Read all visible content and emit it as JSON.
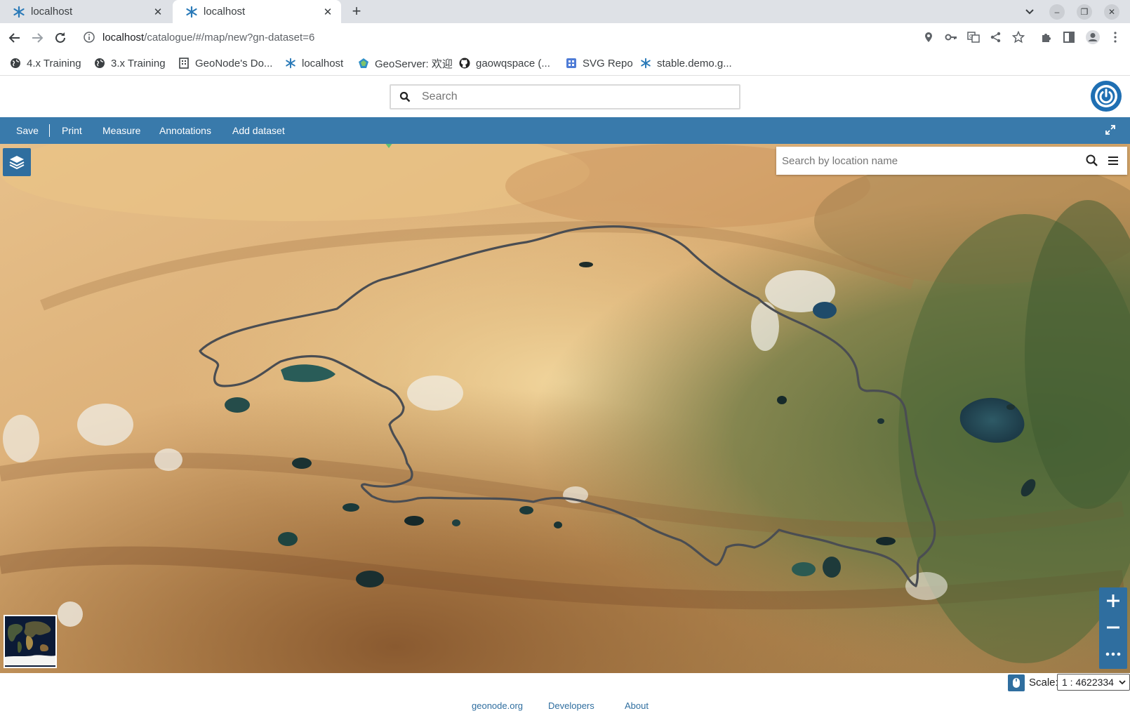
{
  "browser": {
    "tabs": [
      {
        "title": "localhost",
        "active": false
      },
      {
        "title": "localhost",
        "active": true
      }
    ],
    "url_host": "localhost",
    "url_path": "/catalogue/#/map/new?gn-dataset=6",
    "bookmarks": [
      {
        "label": "4.x Training",
        "icon": "globe-icon"
      },
      {
        "label": "3.x Training",
        "icon": "globe-icon"
      },
      {
        "label": "GeoNode's Do...",
        "icon": "building-icon"
      },
      {
        "label": "localhost",
        "icon": "geonode-icon"
      },
      {
        "label": "GeoServer: 欢迎",
        "icon": "geoserver-icon"
      },
      {
        "label": "gaowqspace (...",
        "icon": "github-icon"
      },
      {
        "label": "SVG Repo",
        "icon": "svgrepo-icon"
      },
      {
        "label": "stable.demo.g...",
        "icon": "geonode-icon"
      }
    ]
  },
  "header": {
    "search_placeholder": "Search"
  },
  "menu": {
    "items": [
      "Save",
      "Print",
      "Measure",
      "Annotations",
      "Add dataset"
    ]
  },
  "map": {
    "location_search_placeholder": "Search by location name",
    "basemap": "satellite imagery",
    "outline_color": "#4a4d52"
  },
  "footer": {
    "scale_label": "Scale:",
    "scale_value": "1 : 4622334",
    "links": [
      "geonode.org",
      "Developers",
      "About"
    ]
  },
  "colors": {
    "brand_blue": "#397aab",
    "button_blue": "#2f6e9f"
  }
}
